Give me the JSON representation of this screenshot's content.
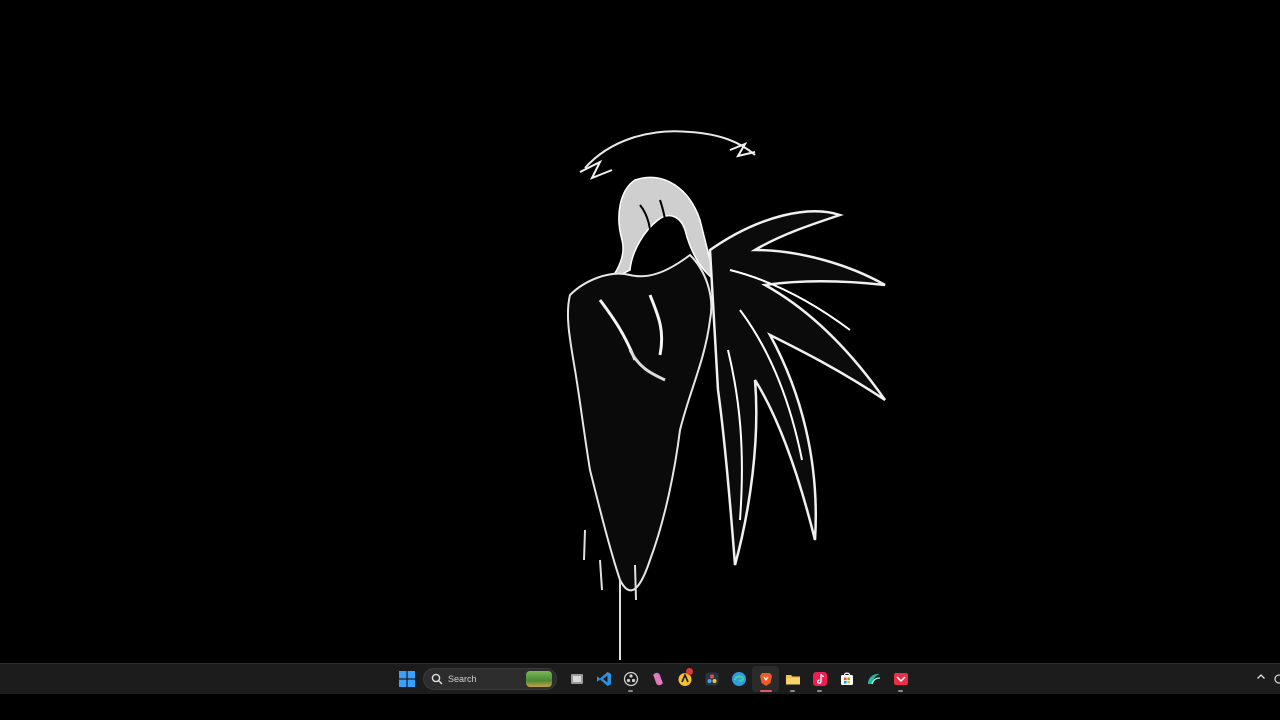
{
  "taskbar": {
    "search_label": "Search",
    "apps": [
      {
        "id": "task-view",
        "icon": "task-view-icon",
        "color": "#d9d9d9"
      },
      {
        "id": "vscode",
        "icon": "vscode-icon",
        "color": "#2f8fe0"
      },
      {
        "id": "obs",
        "icon": "obs-icon",
        "color": "#cfcfcf"
      },
      {
        "id": "copilot",
        "icon": "copilot-icon",
        "color": "#8e6ff2"
      },
      {
        "id": "ai-app",
        "icon": "gradient-app-icon",
        "color": "#f2c230"
      },
      {
        "id": "davinci",
        "icon": "davinci-resolve-icon",
        "color": "#4aa3e6"
      },
      {
        "id": "edge",
        "icon": "edge-icon",
        "color": "#2e9be6"
      },
      {
        "id": "brave",
        "icon": "brave-icon",
        "color": "#f15a24"
      },
      {
        "id": "file-explorer",
        "icon": "folder-icon",
        "color": "#f2c14a"
      },
      {
        "id": "tiktok",
        "icon": "tiktok-icon",
        "color": "#ee1d52"
      },
      {
        "id": "store",
        "icon": "store-icon",
        "color": "#ffffff"
      },
      {
        "id": "wave-app",
        "icon": "wave-icon",
        "color": "#1fb6a6"
      },
      {
        "id": "red-app",
        "icon": "red-app-icon",
        "color": "#e8304a"
      }
    ]
  },
  "colors": {
    "taskbar_bg": "#1c1c1c",
    "desktop_bg": "#000000",
    "start_blue": "#3aa0ff"
  }
}
